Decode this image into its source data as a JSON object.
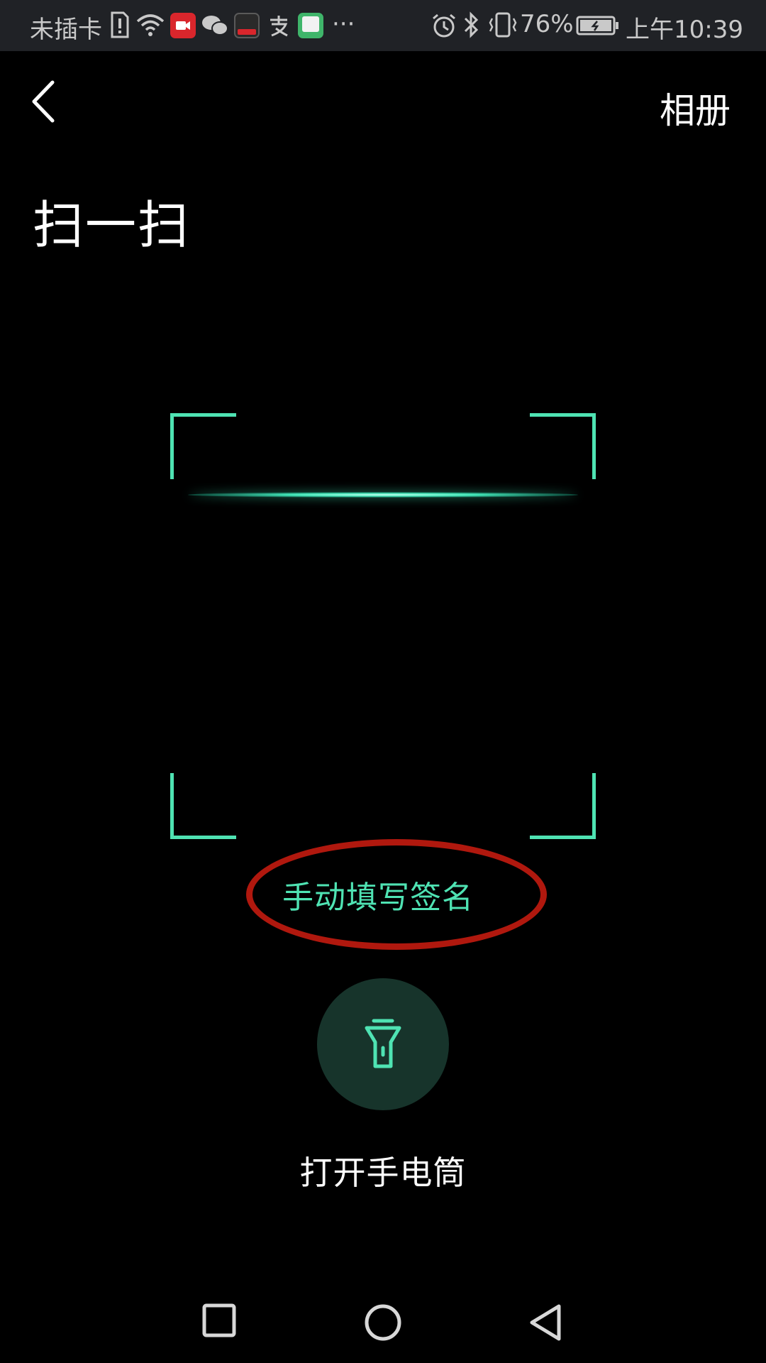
{
  "status_bar": {
    "carrier": "未插卡",
    "battery_percent": "76%",
    "time": "上午10:39",
    "more_indicator": "···",
    "icons": [
      "sim-alert-icon",
      "wifi-icon",
      "video-app-icon",
      "wechat-icon",
      "news-app-icon",
      "alipay-icon",
      "qu-app-icon",
      "alarm-icon",
      "bluetooth-icon",
      "vibrate-icon",
      "battery-icon"
    ]
  },
  "header": {
    "back_icon": "chevron-left-icon",
    "album_label": "相册",
    "title": "扫一扫"
  },
  "scanner": {
    "accent_color": "#4fe3b3",
    "manual_link": "手动填写签名",
    "annotation_color": "#b0180e"
  },
  "flashlight": {
    "icon": "flashlight-icon",
    "label": "打开手电筒"
  },
  "nav_bar": {
    "buttons": [
      "recents-square-icon",
      "home-circle-icon",
      "back-triangle-icon"
    ]
  }
}
